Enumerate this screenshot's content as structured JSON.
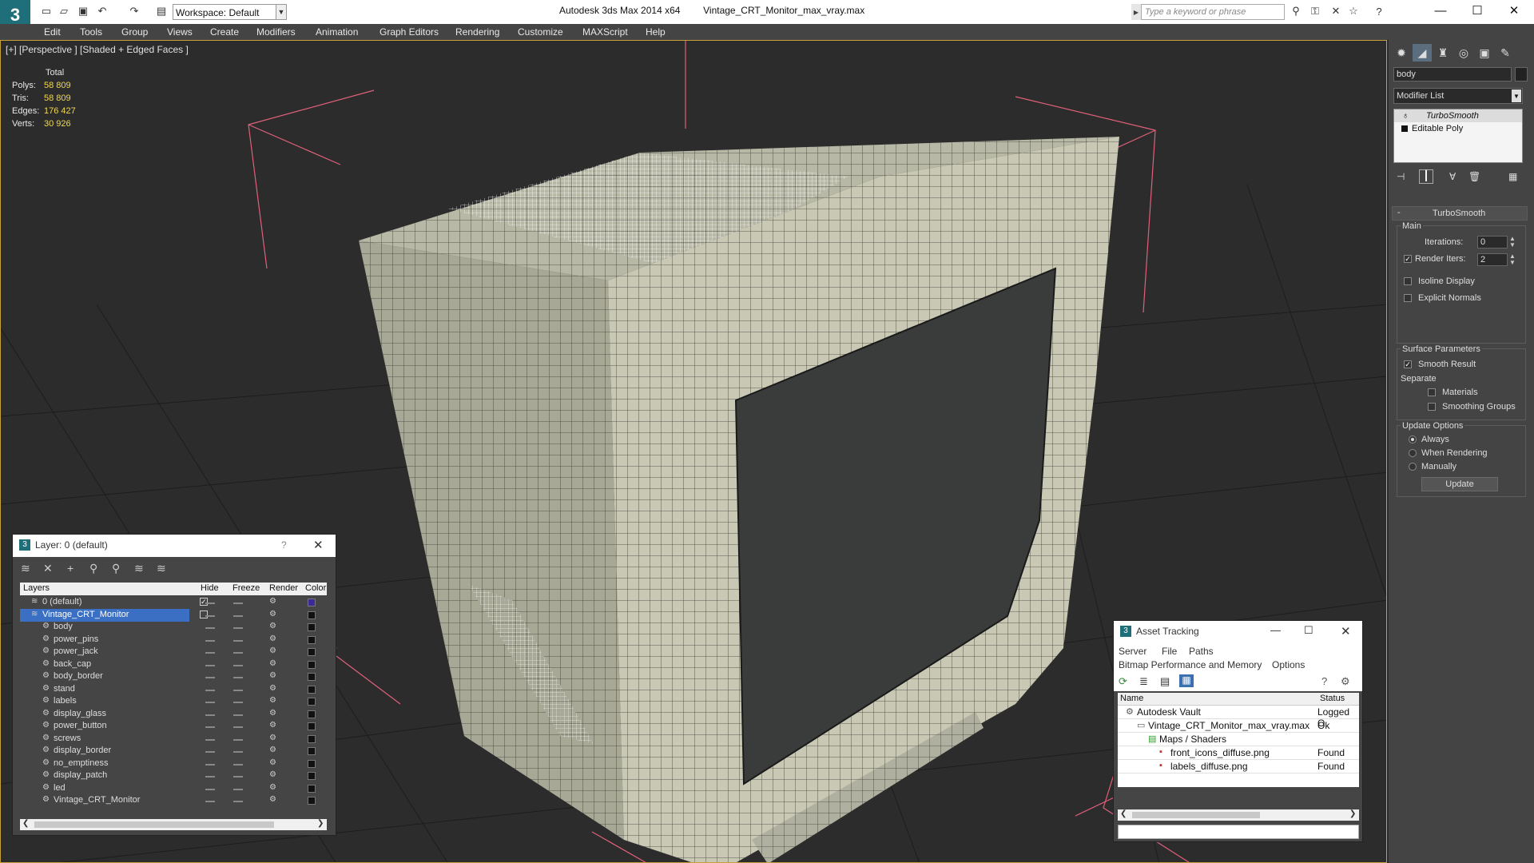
{
  "window": {
    "title": "Autodesk 3ds Max 2014 x64",
    "file": "Vintage_CRT_Monitor_max_vray.max",
    "workspace": "Workspace: Default",
    "search_placeholder": "Type a keyword or phrase"
  },
  "menu": [
    "Edit",
    "Tools",
    "Group",
    "Views",
    "Create",
    "Modifiers",
    "Animation",
    "Graph Editors",
    "Rendering",
    "Customize",
    "MAXScript",
    "Help"
  ],
  "viewport": {
    "label": "[+] [Perspective ] [Shaded + Edged Faces ]",
    "stats": {
      "header": "Total",
      "rows": [
        {
          "label": "Polys:",
          "value": "58 809"
        },
        {
          "label": "Tris:",
          "value": "58 809"
        },
        {
          "label": "Edges:",
          "value": "176 427"
        },
        {
          "label": "Verts:",
          "value": "30 926"
        }
      ]
    }
  },
  "command_panel": {
    "object_name": "body",
    "modifier_list": "Modifier List",
    "stack": [
      "TurboSmooth",
      "Editable Poly"
    ],
    "rollout_title": "TurboSmooth",
    "main_label": "Main",
    "iterations_label": "Iterations:",
    "iterations_value": "0",
    "render_iters_label": "Render Iters:",
    "render_iters_value": "2",
    "isoline_label": "Isoline Display",
    "explicit_normals_label": "Explicit Normals",
    "surface_params_label": "Surface Parameters",
    "smooth_result_label": "Smooth Result",
    "separate_label": "Separate",
    "materials_label": "Materials",
    "smoothing_groups_label": "Smoothing Groups",
    "update_options_label": "Update Options",
    "always_label": "Always",
    "when_rendering_label": "When Rendering",
    "manually_label": "Manually",
    "update_button": "Update"
  },
  "layer_panel": {
    "title": "Layer: 0 (default)",
    "help": "?",
    "columns": [
      "Layers",
      "Hide",
      "Freeze",
      "Render",
      "Color"
    ],
    "layers": [
      {
        "name": "0 (default)",
        "level": 0,
        "color": "#3a2a9a"
      },
      {
        "name": "Vintage_CRT_Monitor",
        "level": 0,
        "selected": true,
        "color": "#111111"
      },
      {
        "name": "body",
        "level": 1,
        "color": "#111111"
      },
      {
        "name": "power_pins",
        "level": 1,
        "color": "#111111"
      },
      {
        "name": "power_jack",
        "level": 1,
        "color": "#111111"
      },
      {
        "name": "back_cap",
        "level": 1,
        "color": "#111111"
      },
      {
        "name": "body_border",
        "level": 1,
        "color": "#111111"
      },
      {
        "name": "stand",
        "level": 1,
        "color": "#111111"
      },
      {
        "name": "labels",
        "level": 1,
        "color": "#111111"
      },
      {
        "name": "display_glass",
        "level": 1,
        "color": "#111111"
      },
      {
        "name": "power_button",
        "level": 1,
        "color": "#111111"
      },
      {
        "name": "screws",
        "level": 1,
        "color": "#111111"
      },
      {
        "name": "display_border",
        "level": 1,
        "color": "#111111"
      },
      {
        "name": "no_emptiness",
        "level": 1,
        "color": "#111111"
      },
      {
        "name": "display_patch",
        "level": 1,
        "color": "#111111"
      },
      {
        "name": "led",
        "level": 1,
        "color": "#111111"
      },
      {
        "name": "Vintage_CRT_Monitor",
        "level": 1,
        "color": "#111111"
      }
    ]
  },
  "asset_panel": {
    "title": "Asset Tracking",
    "menu1": [
      "Server",
      "File",
      "Paths"
    ],
    "menu2": [
      "Bitmap Performance and Memory",
      "Options"
    ],
    "columns": [
      "Name",
      "Status"
    ],
    "rows": [
      {
        "name": "Autodesk Vault",
        "status": "Logged O",
        "level": 0
      },
      {
        "name": "Vintage_CRT_Monitor_max_vray.max",
        "status": "Ok",
        "level": 1
      },
      {
        "name": "Maps / Shaders",
        "status": "",
        "level": 2
      },
      {
        "name": "front_icons_diffuse.png",
        "status": "Found",
        "level": 3
      },
      {
        "name": "labels_diffuse.png",
        "status": "Found",
        "level": 3
      }
    ]
  }
}
